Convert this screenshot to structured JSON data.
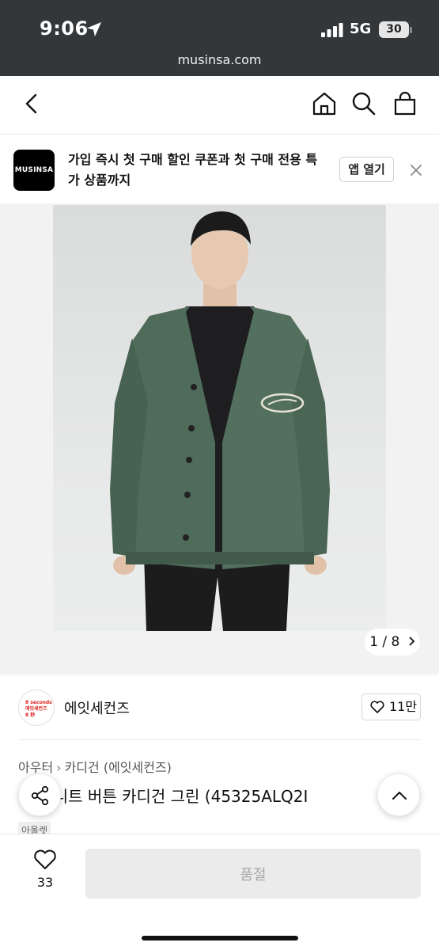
{
  "status_bar": {
    "time": "9:06",
    "network": "5G",
    "battery": "30"
  },
  "browser": {
    "url": "musinsa.com"
  },
  "nav": {
    "icons": [
      "back-icon",
      "home-icon",
      "search-icon",
      "bag-icon"
    ]
  },
  "app_banner": {
    "logo_text": "MUSINSA",
    "message": "가입 즉시 첫 구매 할인 쿠폰과 첫 구매 전용 특가 상품까지",
    "open_label": "앱 열기"
  },
  "gallery": {
    "counter": "1 / 8"
  },
  "brand": {
    "avatar_lines": [
      "8 seconds",
      "에잇세컨즈",
      "8 秒"
    ],
    "name": "에잇세컨즈",
    "likes": "11만"
  },
  "product": {
    "breadcrumb": [
      "아우터",
      "카디건 (에잇세컨즈)"
    ],
    "title": "…치 니트 버튼 카디건 그린 (45325ALQ2I",
    "tag": "아울렛"
  },
  "bottom_bar": {
    "wish_count": "33",
    "buy_label": "품절"
  },
  "colors": {
    "status_bg": "#34373a",
    "cardigan_green": "#4f6b59",
    "button_disabled": "#ebebeb"
  }
}
